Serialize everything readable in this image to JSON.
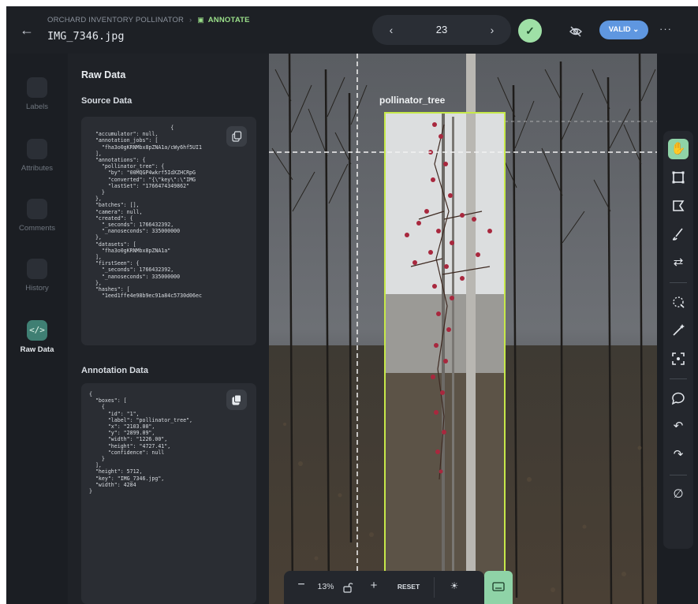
{
  "header": {
    "breadcrumb_project": "ORCHARD INVENTORY POLLINATOR",
    "breadcrumb_separator": "›",
    "breadcrumb_current": "ANNOTATE",
    "filename": "IMG_7346.jpg",
    "page_number": "23",
    "status_label": "VALID ⌄",
    "more_label": "···"
  },
  "sidebar": {
    "items": [
      {
        "label": "Labels",
        "icon": "tag-icon"
      },
      {
        "label": "Attributes",
        "icon": "list-icon"
      },
      {
        "label": "Comments",
        "icon": "comment-icon"
      },
      {
        "label": "History",
        "icon": "history-icon"
      },
      {
        "label": "Raw Data",
        "icon": "code-icon"
      }
    ]
  },
  "panel": {
    "title": "Raw Data",
    "source_title": "Source Data",
    "source_json": "                          {\n  \"accumulator\": null,\n  \"annotation_jobs\": [\n    \"fha3o0gKRNMbx8pZNA1a/cWy6hf5UI1\n  ],\n  \"annotations\": {\n    \"pollinator_tree\": {\n      \"by\": \"00MQGP4wkrf5IdXZHCRpG\n      \"converted\": \"{\\\"key\\\":\\\"IMG\n      \"lastSet\": \"1766474349862\"\n    }\n  },\n  \"batches\": [],\n  \"camera\": null,\n  \"created\": {\n    \"_seconds\": 1766432392,\n    \"_nanoseconds\": 335000000\n  },\n  \"datasets\": [\n    \"fha3o0gKRNMbx8pZNA1a\"\n  ],\n  \"firstSeen\": {\n    \"_seconds\": 1766432392,\n    \"_nanoseconds\": 335000000\n  },\n  \"hashes\": [\n    \"1eed1ffe4e98b9ec91a84c5730d06ec",
    "annotation_title": "Annotation Data",
    "annotation_json": "{\n  \"boxes\": [\n    {\n      \"id\": \"1\",\n      \"label\": \"pollinator_tree\",\n      \"x\": \"2103.00\",\n      \"y\": \"2899.09\",\n      \"width\": \"1226.00\",\n      \"height\": \"4727.41\",\n      \"confidence\": null\n    }\n  ],\n  \"height\": 5712,\n  \"key\": \"IMG_7346.jpg\",\n  \"width\": 4284\n}"
  },
  "canvas": {
    "box_label": "pollinator_tree",
    "box_color": "#c6e84a"
  },
  "zoom": {
    "minus": "−",
    "percent": "13%",
    "plus": "+",
    "reset": "RESET",
    "brightness": "☀"
  },
  "colors": {
    "accent_green": "#8fd3a7",
    "valid_blue": "#5f97e0",
    "active_rail": "#3f7f73"
  }
}
